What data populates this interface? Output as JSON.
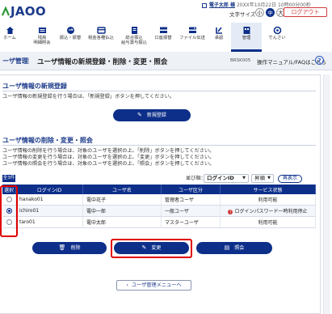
{
  "header": {
    "logo_text": "JAOO",
    "user_name": "電子太郎 様",
    "last_login": "20XX年10月22日 10時00分00秒",
    "font_size_label": "文字サイズ",
    "font_sizes": [
      "小",
      "中",
      "大"
    ],
    "logout_label": "ログアウト"
  },
  "nav": {
    "items": [
      {
        "label": "ホーム",
        "icon": "home-icon"
      },
      {
        "label": "残高\n明細照会",
        "icon": "balance-icon"
      },
      {
        "label": "振込・振替",
        "icon": "transfer-icon"
      },
      {
        "label": "税金各種払込",
        "icon": "tax-payment-icon"
      },
      {
        "label": "総合振込\n給与賞与振込",
        "icon": "bulk-transfer-icon"
      },
      {
        "label": "口座振替",
        "icon": "debit-icon"
      },
      {
        "label": "ファイル伝送",
        "icon": "file-transfer-icon"
      },
      {
        "label": "承認",
        "icon": "approval-icon"
      },
      {
        "label": "管理",
        "icon": "admin-icon"
      },
      {
        "label": "でんさい",
        "icon": "densai-icon"
      }
    ]
  },
  "titlebar": {
    "section": "ーザ管理",
    "title": "ユーザ情報の新規登録・削除・変更・照会",
    "screen_id": "BRSK005",
    "help": "操作マニュアル/FAQはこちら",
    "help_icon": "?"
  },
  "register": {
    "heading": "ユーザ情報の新規登録",
    "note": "ユーザ情報の新規登録を行う場合は、「新規登録」ボタンを押してください。",
    "button_label": "新規登録",
    "button_icon": "pencil-icon"
  },
  "manage": {
    "heading": "ユーザ情報の削除・変更・照会",
    "notes": [
      "ユーザ情報の削除を行う場合は、対象のユーザを選択の上、「削除」ボタンを押してください。",
      "ユーザ情報の変更を行う場合は、対象のユーザを選択の上、「変更」ボタンを押してください。",
      "ユーザ情報の照会を行う場合は、対象のユーザを選択の上、「照会」ボタンを押してください。"
    ],
    "count_label": "全3件",
    "sort_label": "並び順：",
    "sort_field": "ログインID",
    "sort_order": "昇順",
    "reshow_label": "再表示",
    "columns": [
      "選択",
      "ログインID",
      "ユーザ名",
      "ユーザ区分",
      "サービス状態"
    ],
    "rows": [
      {
        "selected": false,
        "login_id": "hanako01",
        "user_name": "電中花子",
        "user_type": "管理者ユーザ",
        "status": "利用可能",
        "warn": false
      },
      {
        "selected": true,
        "login_id": "ichiro01",
        "user_name": "電中一郎",
        "user_type": "一般ユーザ",
        "status": "ログインパスワード一時利用停止",
        "warn": true
      },
      {
        "selected": false,
        "login_id": "taro01",
        "user_name": "電中太郎",
        "user_type": "マスターユーザ",
        "status": "利用可能",
        "warn": false
      }
    ],
    "actions": {
      "delete": "削除",
      "change": "変更",
      "inquiry": "照会"
    }
  },
  "back_button": "ユーザ管理メニューへ",
  "colors": {
    "brand": "#0d2f8a",
    "highlight": "#e00000",
    "warning": "#d23a3a"
  }
}
